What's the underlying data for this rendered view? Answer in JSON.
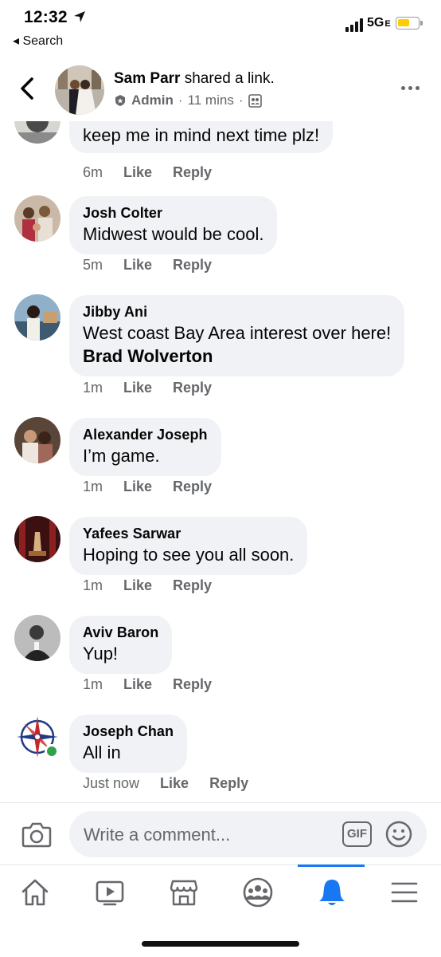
{
  "status": {
    "time": "12:32",
    "back_label": "◂ Search",
    "network": "5G",
    "network_suffix": "E"
  },
  "post": {
    "author": "Sam Parr",
    "action": "shared a link.",
    "role": "Admin",
    "time": "11 mins",
    "separator": "·"
  },
  "comments": [
    {
      "name": "",
      "text": "keep me in mind next time plz!",
      "mention": "",
      "time": "6m",
      "like": "Like",
      "reply": "Reply"
    },
    {
      "name": "Josh Colter",
      "text": "Midwest would be cool.",
      "mention": "",
      "time": "5m",
      "like": "Like",
      "reply": "Reply"
    },
    {
      "name": "Jibby Ani",
      "text": "West coast Bay Area interest over here! ",
      "mention": "Brad Wolverton",
      "time": "1m",
      "like": "Like",
      "reply": "Reply"
    },
    {
      "name": "Alexander Joseph",
      "text": "I’m game.",
      "mention": "",
      "time": "1m",
      "like": "Like",
      "reply": "Reply"
    },
    {
      "name": "Yafees Sarwar",
      "text": "Hoping to see you all soon.",
      "mention": "",
      "time": "1m",
      "like": "Like",
      "reply": "Reply"
    },
    {
      "name": "Aviv Baron",
      "text": "Yup!",
      "mention": "",
      "time": "1m",
      "like": "Like",
      "reply": "Reply"
    },
    {
      "name": "Joseph Chan",
      "text": "All in",
      "mention": "",
      "time": "Just now",
      "like": "Like",
      "reply": "Reply"
    }
  ],
  "composer": {
    "placeholder": "Write a comment...",
    "gif_label": "GIF"
  },
  "tabs": [
    {
      "icon": "home-icon"
    },
    {
      "icon": "watch-icon"
    },
    {
      "icon": "marketplace-icon"
    },
    {
      "icon": "groups-icon"
    },
    {
      "icon": "notifications-icon",
      "active": true
    },
    {
      "icon": "menu-icon"
    }
  ],
  "colors": {
    "accent": "#1877f2",
    "bubble": "#f0f2f5",
    "secondary_text": "#65676b",
    "online": "#31a24c"
  }
}
